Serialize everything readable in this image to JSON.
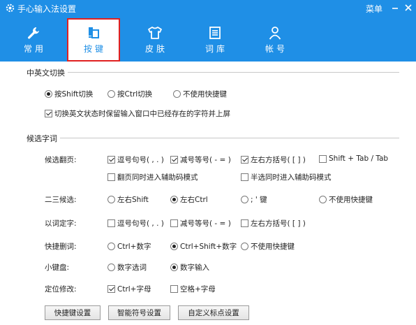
{
  "window": {
    "title": "手心输入法设置",
    "menu_label": "菜单",
    "minimize_label": "–",
    "close_label": "×"
  },
  "tabs": [
    {
      "label": "常用",
      "icon": "wrench-icon"
    },
    {
      "label": "按键",
      "icon": "keyboard-icon",
      "active": true
    },
    {
      "label": "皮肤",
      "icon": "tshirt-icon"
    },
    {
      "label": "词库",
      "icon": "book-icon"
    },
    {
      "label": "帐号",
      "icon": "user-icon"
    }
  ],
  "section_switch": {
    "title": "中英文切换",
    "options": [
      {
        "label": "按Shift切换",
        "selected": true
      },
      {
        "label": "按Ctrl切换",
        "selected": false
      },
      {
        "label": "不使用快捷键",
        "selected": false
      }
    ],
    "keep_text": {
      "label": "切换英文状态时保留输入窗口中已经存在的字符并上屏",
      "checked": true
    }
  },
  "section_candidates": {
    "title": "候选字词",
    "paging": {
      "label": "候选翻页:",
      "options": [
        {
          "label": "逗号句号( , . )",
          "checked": true
        },
        {
          "label": "减号等号( - = )",
          "checked": true
        },
        {
          "label": "左右方括号( [ ] )",
          "checked": true
        },
        {
          "label": "Shift + Tab / Tab",
          "checked": false
        },
        {
          "label": "翻页同时进入辅助码模式",
          "checked": false
        },
        {
          "label": "半选同时进入辅助码模式",
          "checked": false
        }
      ]
    },
    "second_third": {
      "label": "二三候选:",
      "options": [
        {
          "label": "左右Shift",
          "selected": false
        },
        {
          "label": "左右Ctrl",
          "selected": true
        },
        {
          "label": "; ' 键",
          "selected": false
        },
        {
          "label": "不使用快捷键",
          "selected": false
        }
      ]
    },
    "word_to_char": {
      "label": "以词定字:",
      "options": [
        {
          "label": "逗号句号( , . )",
          "checked": false
        },
        {
          "label": "减号等号( - = )",
          "checked": false
        },
        {
          "label": "左右方括号( [ ] )",
          "checked": false
        }
      ]
    },
    "quick_delete": {
      "label": "快捷删词:",
      "options": [
        {
          "label": "Ctrl+数字",
          "selected": false
        },
        {
          "label": "Ctrl+Shift+数字",
          "selected": true
        },
        {
          "label": "不使用快捷键",
          "selected": false
        }
      ]
    },
    "keypad": {
      "label": "小键盘:",
      "options": [
        {
          "label": "数字选词",
          "selected": false
        },
        {
          "label": "数字输入",
          "selected": true
        }
      ]
    },
    "locate_edit": {
      "label": "定位修改:",
      "options": [
        {
          "label": "Ctrl+字母",
          "checked": true
        },
        {
          "label": "空格+字母",
          "checked": false
        }
      ]
    }
  },
  "buttons": {
    "hotkey_settings": "快捷键设置",
    "smart_symbol_settings": "智能符号设置",
    "custom_punct_settings": "自定义标点设置"
  },
  "colors": {
    "header_blue": "#1f8fe6",
    "active_tab_border": "#e02020"
  }
}
